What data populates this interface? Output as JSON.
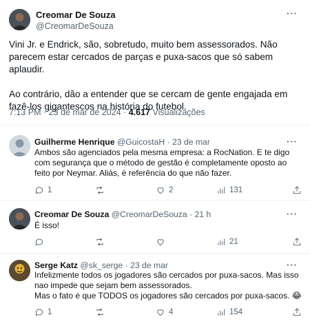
{
  "main_tweet": {
    "author_name": "Creomar De Souza",
    "author_handle": "@CreomarDeSouza",
    "paragraph1": "Vini Jr. e Endrick, são, sobretudo, muito bem assessorados. Não parecem estar cercados de parças e puxa-sacos que só sabem aplaudir.",
    "paragraph2": "Ao contrário, dão a entender que se cercam de gente engajada em fazê-los gigantescos na história do futebol.",
    "time": "7:13 PM · 23 de mar de 2024 · ",
    "views_count": "4.617",
    "views_label": " Visualizações",
    "more": "···"
  },
  "replies": [
    {
      "name": "Guilherme Henrique",
      "handle": "@GuicostaH",
      "sep": " · ",
      "time": "23 de mar",
      "text": "Ambos são agenciados pela mesma empresa: a RocNation. E te digo com segurança que o método de gestão é completamente oposto ao feito por Neymar. Aliás, é referência do que não fazer.",
      "replies_count": "1",
      "retweets_count": "",
      "likes_count": "2",
      "views_count": "131",
      "more": "···"
    },
    {
      "name": "Creomar De Souza",
      "handle": "@CreomarDeSouza",
      "sep": " · ",
      "time": "21 h",
      "text": "É isso!",
      "replies_count": "",
      "retweets_count": "",
      "likes_count": "",
      "views_count": "21",
      "more": "···"
    },
    {
      "name": "Serge Katz",
      "handle": "@sk_serge",
      "sep": " · ",
      "time": "23 de mar",
      "text_line1": "Infelizmente todos os jogadores são cercados por puxa-sacos. Mas isso nao impede que sejam bem assessorados.",
      "text_line2": "Mas o fato é que TODOS os jogadores são cercados por puxa-sacos. 😂",
      "replies_count": "1",
      "retweets_count": "",
      "likes_count": "4",
      "views_count": "154",
      "more": "···"
    }
  ],
  "colors": {
    "text": "#0f1419",
    "muted": "#536471",
    "divider": "#eff3f4"
  },
  "icons": [
    "reply-icon",
    "retweet-icon",
    "like-icon",
    "views-icon",
    "share-icon",
    "more-icon"
  ]
}
